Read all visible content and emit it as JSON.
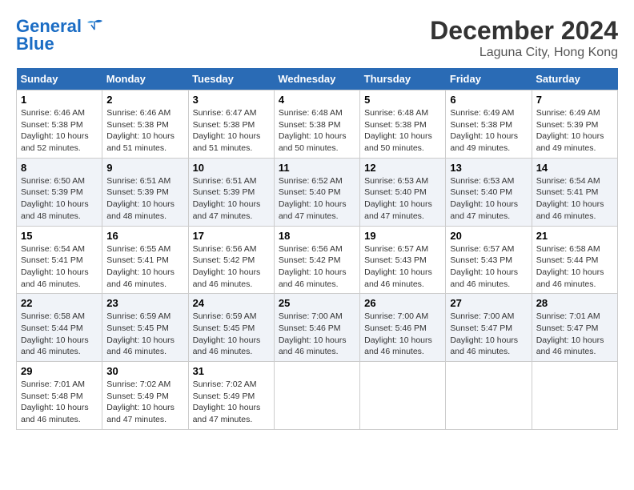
{
  "header": {
    "logo_general": "General",
    "logo_blue": "Blue",
    "month_title": "December 2024",
    "location": "Laguna City, Hong Kong"
  },
  "days_of_week": [
    "Sunday",
    "Monday",
    "Tuesday",
    "Wednesday",
    "Thursday",
    "Friday",
    "Saturday"
  ],
  "weeks": [
    [
      {
        "day": "1",
        "sunrise": "6:46 AM",
        "sunset": "5:38 PM",
        "daylight": "10 hours and 52 minutes."
      },
      {
        "day": "2",
        "sunrise": "6:46 AM",
        "sunset": "5:38 PM",
        "daylight": "10 hours and 51 minutes."
      },
      {
        "day": "3",
        "sunrise": "6:47 AM",
        "sunset": "5:38 PM",
        "daylight": "10 hours and 51 minutes."
      },
      {
        "day": "4",
        "sunrise": "6:48 AM",
        "sunset": "5:38 PM",
        "daylight": "10 hours and 50 minutes."
      },
      {
        "day": "5",
        "sunrise": "6:48 AM",
        "sunset": "5:38 PM",
        "daylight": "10 hours and 50 minutes."
      },
      {
        "day": "6",
        "sunrise": "6:49 AM",
        "sunset": "5:38 PM",
        "daylight": "10 hours and 49 minutes."
      },
      {
        "day": "7",
        "sunrise": "6:49 AM",
        "sunset": "5:39 PM",
        "daylight": "10 hours and 49 minutes."
      }
    ],
    [
      {
        "day": "8",
        "sunrise": "6:50 AM",
        "sunset": "5:39 PM",
        "daylight": "10 hours and 48 minutes."
      },
      {
        "day": "9",
        "sunrise": "6:51 AM",
        "sunset": "5:39 PM",
        "daylight": "10 hours and 48 minutes."
      },
      {
        "day": "10",
        "sunrise": "6:51 AM",
        "sunset": "5:39 PM",
        "daylight": "10 hours and 47 minutes."
      },
      {
        "day": "11",
        "sunrise": "6:52 AM",
        "sunset": "5:40 PM",
        "daylight": "10 hours and 47 minutes."
      },
      {
        "day": "12",
        "sunrise": "6:53 AM",
        "sunset": "5:40 PM",
        "daylight": "10 hours and 47 minutes."
      },
      {
        "day": "13",
        "sunrise": "6:53 AM",
        "sunset": "5:40 PM",
        "daylight": "10 hours and 47 minutes."
      },
      {
        "day": "14",
        "sunrise": "6:54 AM",
        "sunset": "5:41 PM",
        "daylight": "10 hours and 46 minutes."
      }
    ],
    [
      {
        "day": "15",
        "sunrise": "6:54 AM",
        "sunset": "5:41 PM",
        "daylight": "10 hours and 46 minutes."
      },
      {
        "day": "16",
        "sunrise": "6:55 AM",
        "sunset": "5:41 PM",
        "daylight": "10 hours and 46 minutes."
      },
      {
        "day": "17",
        "sunrise": "6:56 AM",
        "sunset": "5:42 PM",
        "daylight": "10 hours and 46 minutes."
      },
      {
        "day": "18",
        "sunrise": "6:56 AM",
        "sunset": "5:42 PM",
        "daylight": "10 hours and 46 minutes."
      },
      {
        "day": "19",
        "sunrise": "6:57 AM",
        "sunset": "5:43 PM",
        "daylight": "10 hours and 46 minutes."
      },
      {
        "day": "20",
        "sunrise": "6:57 AM",
        "sunset": "5:43 PM",
        "daylight": "10 hours and 46 minutes."
      },
      {
        "day": "21",
        "sunrise": "6:58 AM",
        "sunset": "5:44 PM",
        "daylight": "10 hours and 46 minutes."
      }
    ],
    [
      {
        "day": "22",
        "sunrise": "6:58 AM",
        "sunset": "5:44 PM",
        "daylight": "10 hours and 46 minutes."
      },
      {
        "day": "23",
        "sunrise": "6:59 AM",
        "sunset": "5:45 PM",
        "daylight": "10 hours and 46 minutes."
      },
      {
        "day": "24",
        "sunrise": "6:59 AM",
        "sunset": "5:45 PM",
        "daylight": "10 hours and 46 minutes."
      },
      {
        "day": "25",
        "sunrise": "7:00 AM",
        "sunset": "5:46 PM",
        "daylight": "10 hours and 46 minutes."
      },
      {
        "day": "26",
        "sunrise": "7:00 AM",
        "sunset": "5:46 PM",
        "daylight": "10 hours and 46 minutes."
      },
      {
        "day": "27",
        "sunrise": "7:00 AM",
        "sunset": "5:47 PM",
        "daylight": "10 hours and 46 minutes."
      },
      {
        "day": "28",
        "sunrise": "7:01 AM",
        "sunset": "5:47 PM",
        "daylight": "10 hours and 46 minutes."
      }
    ],
    [
      {
        "day": "29",
        "sunrise": "7:01 AM",
        "sunset": "5:48 PM",
        "daylight": "10 hours and 46 minutes."
      },
      {
        "day": "30",
        "sunrise": "7:02 AM",
        "sunset": "5:49 PM",
        "daylight": "10 hours and 47 minutes."
      },
      {
        "day": "31",
        "sunrise": "7:02 AM",
        "sunset": "5:49 PM",
        "daylight": "10 hours and 47 minutes."
      },
      null,
      null,
      null,
      null
    ]
  ]
}
